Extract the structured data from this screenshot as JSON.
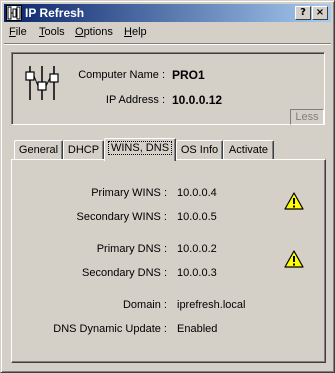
{
  "window": {
    "title": "IP Refresh",
    "help_button": "?",
    "close_button": "×"
  },
  "menu": [
    "File",
    "Tools",
    "Options",
    "Help"
  ],
  "computer": {
    "name_label": "Computer Name :",
    "name_value": "PRO1",
    "ip_label": "IP Address :",
    "ip_value": "10.0.0.12"
  },
  "less_button": "Less",
  "tabs": [
    {
      "label": "General",
      "active": false
    },
    {
      "label": "DHCP",
      "active": false
    },
    {
      "label": "WINS, DNS",
      "active": true
    },
    {
      "label": "OS Info",
      "active": false
    },
    {
      "label": "Activate",
      "active": false
    }
  ],
  "wins_dns": {
    "primary_wins_label": "Primary WINS :",
    "primary_wins_value": "10.0.0.4",
    "secondary_wins_label": "Secondary WINS :",
    "secondary_wins_value": "10.0.0.5",
    "primary_dns_label": "Primary DNS :",
    "primary_dns_value": "10.0.0.2",
    "secondary_dns_label": "Secondary DNS :",
    "secondary_dns_value": "10.0.0.3",
    "domain_label": "Domain :",
    "domain_value": "iprefresh.local",
    "dns_dynamic_label": "DNS Dynamic Update :",
    "dns_dynamic_value": "Enabled"
  },
  "icons": {
    "app": "network-app-icon",
    "computer": "network-adapter-icon",
    "warning": "warning-icon"
  },
  "colors": {
    "title_start": "#0a246a",
    "title_end": "#a6caf0",
    "face": "#d4d0c8",
    "warning": "#ffff00"
  }
}
